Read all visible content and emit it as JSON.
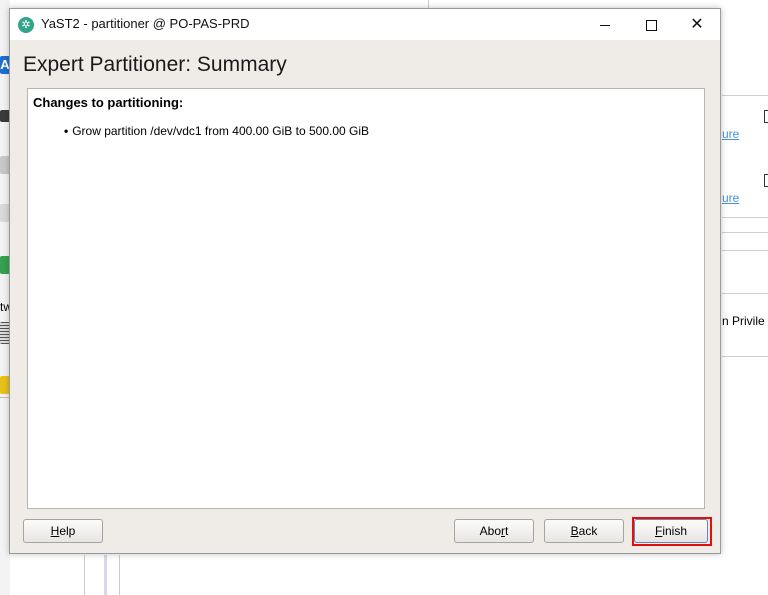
{
  "background": {
    "left_strip_text": "tw",
    "right_link_1": "ure",
    "right_link_2": "ure",
    "right_text": "n Privile"
  },
  "window": {
    "title": "YaST2 - partitioner @ PO-PAS-PRD",
    "minimize_glyph": "—",
    "maximize_glyph": "☐",
    "close_glyph": "✕"
  },
  "dialog": {
    "heading": "Expert Partitioner: Summary",
    "changes_heading": "Changes to partitioning:",
    "changes": [
      "Grow partition /dev/vdc1 from 400.00 GiB to 500.00 GiB"
    ]
  },
  "buttons": {
    "help": {
      "pre": "",
      "mnemonic": "H",
      "post": "elp"
    },
    "abort": {
      "pre": "Abo",
      "mnemonic": "r",
      "post": "t"
    },
    "back": {
      "pre": "",
      "mnemonic": "B",
      "post": "ack"
    },
    "finish": {
      "pre": "",
      "mnemonic": "F",
      "post": "inish"
    }
  },
  "colors": {
    "window_bg": "#efebe7",
    "highlight": "#e01010",
    "app_icon": "#30a58a"
  }
}
